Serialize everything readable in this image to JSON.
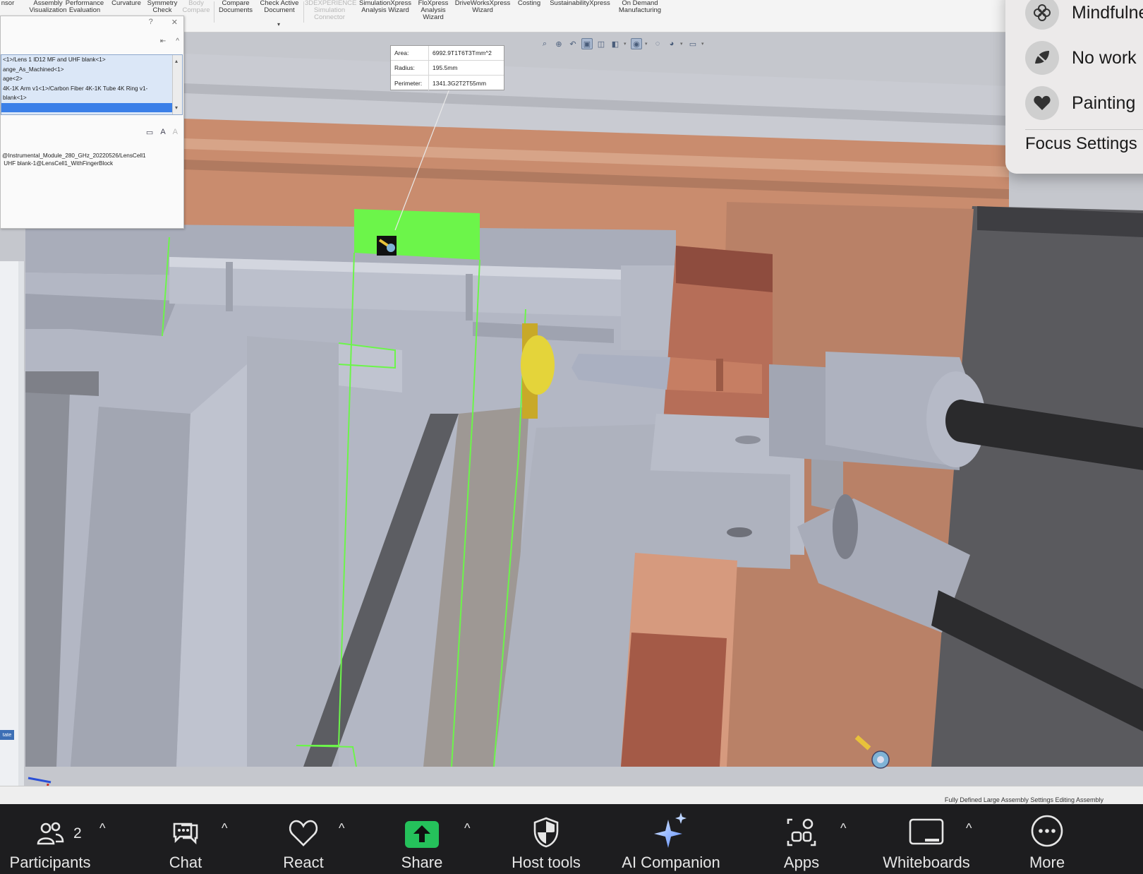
{
  "ribbon": {
    "items": [
      {
        "label": "nsor"
      },
      {
        "label": "Assembly\nVisualization"
      },
      {
        "label": "Performance\nEvaluation"
      },
      {
        "label": "Curvature"
      },
      {
        "label": "Symmetry\nCheck"
      },
      {
        "label": "Body\nCompare"
      },
      {
        "label": "Compare\nDocuments"
      },
      {
        "label": "Check Active\nDocument"
      },
      {
        "label": "3DEXPERIENCE\nSimulation\nConnector"
      },
      {
        "label": "SimulationXpress\nAnalysis Wizard"
      },
      {
        "label": "FloXpress\nAnalysis\nWizard"
      },
      {
        "label": "DriveWorksXpress\nWizard"
      },
      {
        "label": "Costing"
      },
      {
        "label": "SustainabilityXpress"
      },
      {
        "label": "On Demand\nManufacturing"
      }
    ],
    "caret": "▾"
  },
  "measure": {
    "area_label": "Area:",
    "area_value": "6992.9T1T6T3Tmm^2",
    "radius_label": "Radius:",
    "radius_value": "195.5mm",
    "perimeter_label": "Perimeter:",
    "perimeter_value": "1341.3G2T2T55mm"
  },
  "panel": {
    "help": "?",
    "close": "✕",
    "pin": "⇤",
    "collapse": "^",
    "list_items": [
      "<1>/Lens 1 ID12 MF and UHF blank<1>",
      "ange_As_Machined<1>",
      "age<2>",
      "4K-1K Arm v1<1>/Carbon Fiber 4K-1K Tube 4K Ring v1-",
      "blank<1>",
      ""
    ],
    "path_text": "@Instrumental_Module_280_GHz_20220526/LensCell1\n UHF blank-1@LensCell1_WithFingerBlock"
  },
  "left_strip": {
    "tab_label": "tate"
  },
  "status_bar": {
    "text": "Fully Defined   Large Assembly Settings   Editing Assembly"
  },
  "focus_menu": {
    "items": [
      {
        "label": "Mindfulness",
        "icon": "flower-icon"
      },
      {
        "label": "No work",
        "icon": "leaf-icon"
      },
      {
        "label": "Painting",
        "icon": "heart-icon"
      }
    ],
    "settings_label": "Focus Settings"
  },
  "zoom_toolbar": {
    "participants_label": "Participants",
    "participants_count": "2",
    "chat_label": "Chat",
    "react_label": "React",
    "share_label": "Share",
    "host_tools_label": "Host tools",
    "ai_companion_label": "AI Companion",
    "apps_label": "Apps",
    "whiteboards_label": "Whiteboards",
    "more_label": "More",
    "caret": "^"
  },
  "colors": {
    "selection_green": "#6cf54a",
    "copper": "#b9735e",
    "share_green": "#25c15b"
  }
}
